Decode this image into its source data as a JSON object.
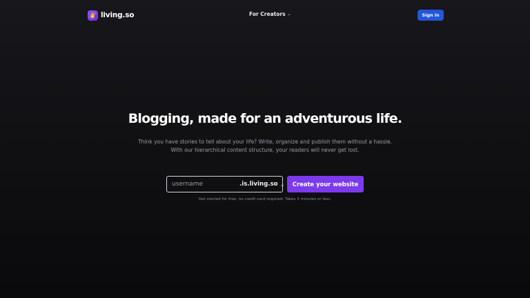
{
  "nav": {
    "brand": "living.so",
    "logo_icon": "hand-wave-icon",
    "menu_creators": "For Creators",
    "signin_label": "Sign in"
  },
  "hero": {
    "title": "Blogging, made for an adventurous life.",
    "subtitle_line1": "Think you have stories to tell about your life? Write, organize and publish them without a hassle.",
    "subtitle_line2": "With our hierarchical content structure, your readers will never get lost."
  },
  "signup": {
    "username_placeholder": "username",
    "domain_suffix": ".is.living.so",
    "cta_label": "Create your website",
    "note": "Get started for free, no credit card required. Takes 3 minutes or less."
  },
  "colors": {
    "accent": "#7c3aed",
    "signin": "#2456d8",
    "background": "#111114"
  }
}
